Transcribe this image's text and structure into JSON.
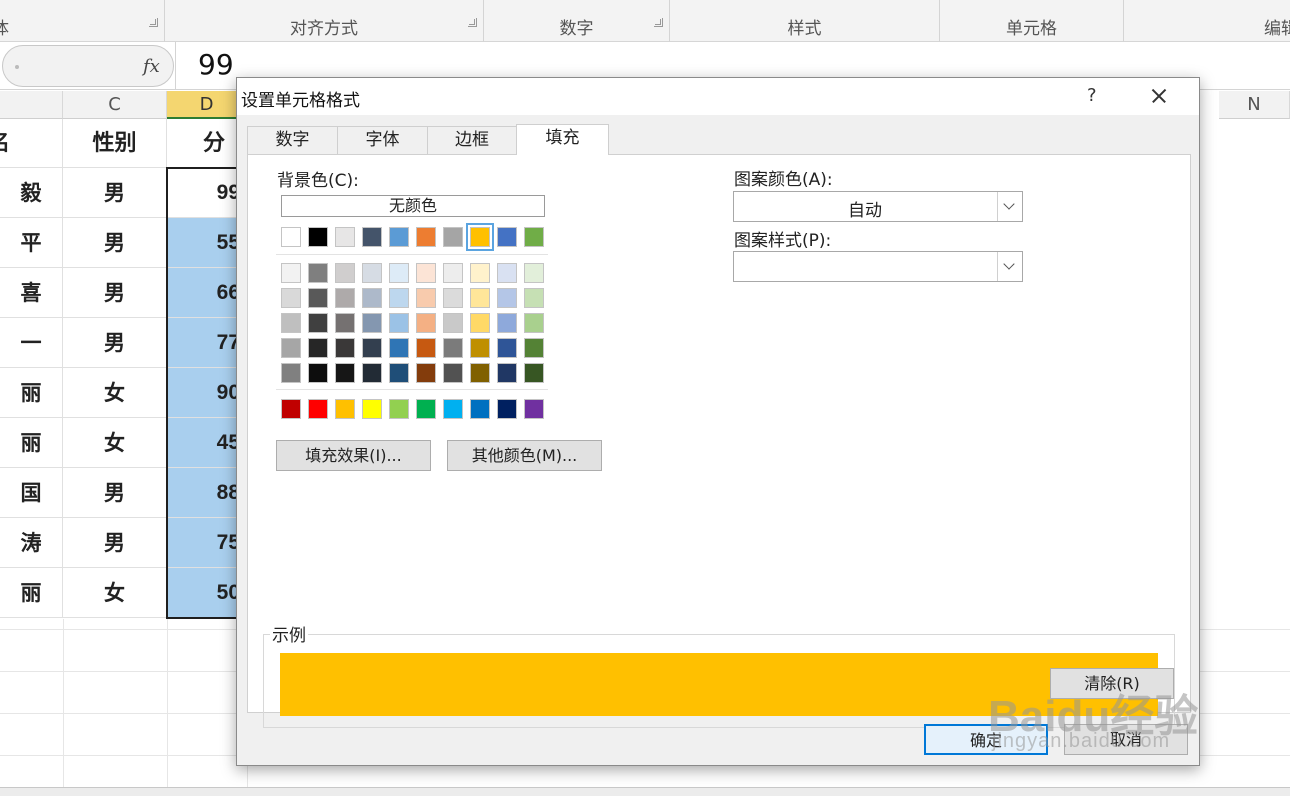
{
  "ribbon": {
    "groups": [
      {
        "label": "体"
      },
      {
        "label": "对齐方式"
      },
      {
        "label": "数字"
      },
      {
        "label": "样式"
      },
      {
        "label": "单元格"
      },
      {
        "label": "编辑"
      }
    ]
  },
  "formula_bar": {
    "fx": "fx",
    "value": "99"
  },
  "columns": {
    "c": "C",
    "d": "D",
    "n": "N"
  },
  "sheet": {
    "header": {
      "name_partial": "名",
      "gender": "性别",
      "score_partial": "分数"
    },
    "rows": [
      {
        "name": "毅",
        "gender": "男",
        "score": "99"
      },
      {
        "name": "平",
        "gender": "男",
        "score": "55"
      },
      {
        "name": "喜",
        "gender": "男",
        "score": "66"
      },
      {
        "name": "一",
        "gender": "男",
        "score": "77"
      },
      {
        "name": "丽",
        "gender": "女",
        "score": "90"
      },
      {
        "name": "丽",
        "gender": "女",
        "score": "45"
      },
      {
        "name": "国",
        "gender": "男",
        "score": "88"
      },
      {
        "name": "涛",
        "gender": "男",
        "score": "75"
      },
      {
        "name": "丽",
        "gender": "女",
        "score": "50"
      }
    ]
  },
  "dialog": {
    "title": "设置单元格格式",
    "help": "?",
    "tabs": [
      "数字",
      "字体",
      "边框",
      "填充"
    ],
    "active_tab": "填充",
    "background_color_label": "背景色(C):",
    "no_color": "无颜色",
    "pattern_color_label": "图案颜色(A):",
    "pattern_color_value": "自动",
    "pattern_style_label": "图案样式(P):",
    "pattern_style_value": "",
    "fill_effects_button": "填充效果(I)...",
    "more_colors_button": "其他颜色(M)...",
    "sample_label": "示例",
    "sample_color": "#FFC000",
    "clear_button": "清除(R)",
    "ok_button": "确定",
    "cancel_button": "取消",
    "theme_row": [
      "#FFFFFF",
      "#000000",
      "#E7E6E6",
      "#44546A",
      "#5B9BD5",
      "#ED7D31",
      "#A5A5A5",
      "#FFC000",
      "#4472C4",
      "#70AD47"
    ],
    "shade_rows": [
      [
        "#F2F2F2",
        "#7F7F7F",
        "#D0CECE",
        "#D6DCE4",
        "#DDEBF7",
        "#FCE4D6",
        "#EDEDED",
        "#FFF2CC",
        "#D9E1F2",
        "#E2EFDA"
      ],
      [
        "#D9D9D9",
        "#595959",
        "#AEAAAA",
        "#ADB9CA",
        "#BDD7EE",
        "#F8CBAD",
        "#DBDBDB",
        "#FFE699",
        "#B4C6E7",
        "#C6E0B4"
      ],
      [
        "#BFBFBF",
        "#404040",
        "#757171",
        "#8497B0",
        "#9BC2E6",
        "#F4B084",
        "#C9C9C9",
        "#FFD966",
        "#8EA9DB",
        "#A9D08E"
      ],
      [
        "#A6A6A6",
        "#262626",
        "#3A3838",
        "#333F4F",
        "#2F75B5",
        "#C65911",
        "#7B7B7B",
        "#BF8F00",
        "#2F5597",
        "#548235"
      ],
      [
        "#808080",
        "#0D0D0D",
        "#161616",
        "#222B35",
        "#1F4E78",
        "#833C0C",
        "#525252",
        "#806000",
        "#203764",
        "#375623"
      ]
    ],
    "standard_row": [
      "#C00000",
      "#FF0000",
      "#FFC000",
      "#FFFF00",
      "#92D050",
      "#00B050",
      "#00B0F0",
      "#0070C0",
      "#002060",
      "#7030A0"
    ],
    "selected_swatch": "#FFC000"
  },
  "watermark": {
    "brand": "Baidu经验",
    "url": "jingyan.baidu.com"
  }
}
